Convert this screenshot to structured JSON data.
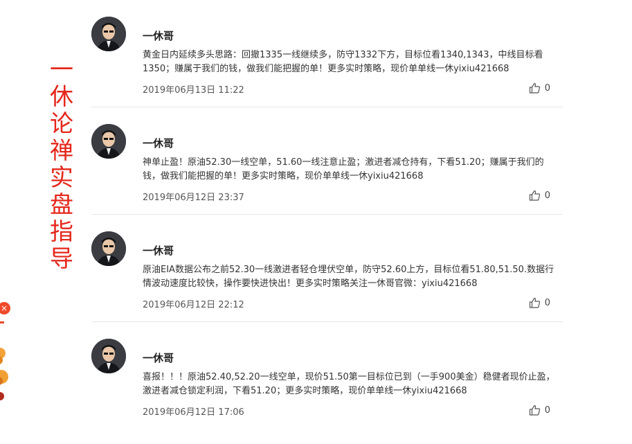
{
  "banner": {
    "chars": [
      "一",
      "休",
      "论",
      "禅",
      "实",
      "盘",
      "指",
      "导"
    ],
    "color": "#e5271c"
  },
  "float_widget": {
    "close_symbol": "×"
  },
  "posts": [
    {
      "author": "一休哥",
      "content": "黄金日内延续多头思路：回撤1335一线继续多，防守1332下方，目标位看1340,1343，中线目标看1350；赚属于我们的钱，做我们能把握的单！更多实时策略，现价单单线一休yixiu421668",
      "time": "2019年06月13日 11:22",
      "likes": "0"
    },
    {
      "author": "一休哥",
      "content": "神单止盈！原油52.30一线空单，51.60一线注意止盈；激进者减仓持有，下看51.20；赚属于我们的钱，做我们能把握的单！更多实时策略，现价单单线一休yixiu421668",
      "time": "2019年06月12日 23:37",
      "likes": "0"
    },
    {
      "author": "一休哥",
      "content": "原油EIA数据公布之前52.30一线激进者轻仓埋伏空单，防守52.60上方，目标位看51.80,51.50.数据行情波动速度比较快，操作要快进快出！更多实时策略关注一休哥官微：yixiu421668",
      "time": "2019年06月12日 22:12",
      "likes": "0"
    },
    {
      "author": "一休哥",
      "content": "喜报！！！原油52.40,52.20一线空单，现价51.50第一目标位已到（一手900美金）稳健者现价止盈，激进者减仓锁定利润，下看51.20；更多实时策略，现价单单线一休yixiu421668",
      "time": "2019年06月12日 17:06",
      "likes": "0"
    }
  ],
  "icons": {
    "like": "thumbs-up-icon",
    "avatar": "user-avatar"
  }
}
